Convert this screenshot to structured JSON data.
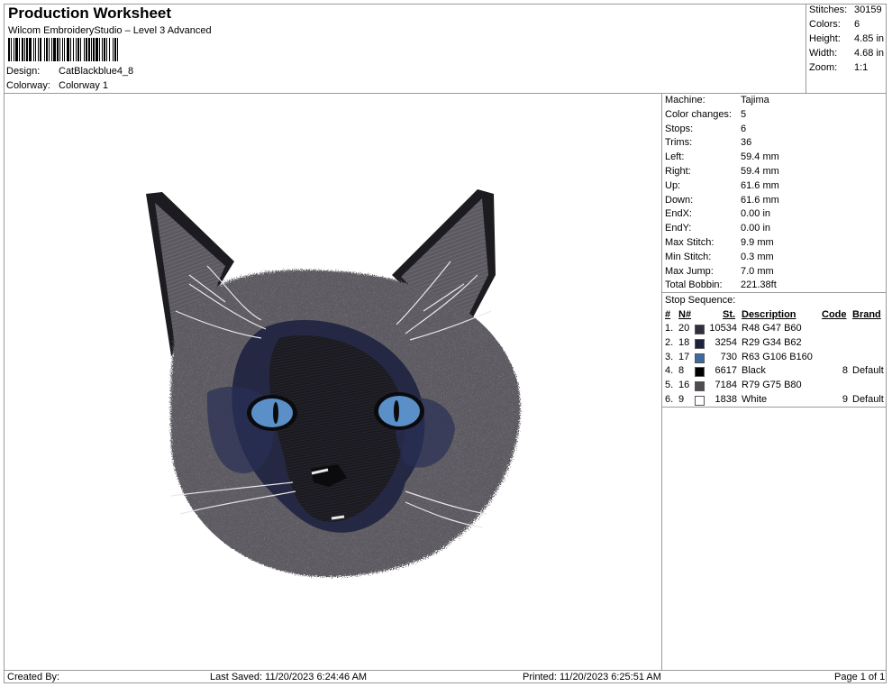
{
  "header": {
    "title": "Production Worksheet",
    "software": "Wilcom EmbroideryStudio – Level 3 Advanced",
    "design_label": "Design:",
    "design_value": "CatBlackblue4_8",
    "colorway_label": "Colorway:",
    "colorway_value": "Colorway 1"
  },
  "summary": {
    "stitches_label": "Stitches:",
    "stitches_value": "30159",
    "colors_label": "Colors:",
    "colors_value": "6",
    "height_label": "Height:",
    "height_value": "4.85 in",
    "width_label": "Width:",
    "width_value": "4.68 in",
    "zoom_label": "Zoom:",
    "zoom_value": "1:1"
  },
  "details": [
    {
      "label": "Machine:",
      "value": "Tajima"
    },
    {
      "label": "Color changes:",
      "value": "5"
    },
    {
      "label": "Stops:",
      "value": "6"
    },
    {
      "label": "Trims:",
      "value": "36"
    },
    {
      "label": "Left:",
      "value": "59.4 mm"
    },
    {
      "label": "Right:",
      "value": "59.4 mm"
    },
    {
      "label": "Up:",
      "value": "61.6 mm"
    },
    {
      "label": "Down:",
      "value": "61.6 mm"
    },
    {
      "label": "EndX:",
      "value": "0.00 in"
    },
    {
      "label": "EndY:",
      "value": "0.00 in"
    },
    {
      "label": "Max Stitch:",
      "value": "9.9 mm"
    },
    {
      "label": "Min Stitch:",
      "value": "0.3 mm"
    },
    {
      "label": "Max Jump:",
      "value": "7.0 mm"
    },
    {
      "label": "Total Bobbin:",
      "value": "221.38ft"
    }
  ],
  "stop_sequence": {
    "title": "Stop Sequence:",
    "headers": {
      "num": "#",
      "n": "N#",
      "st": "St.",
      "description": "Description",
      "code": "Code",
      "brand": "Brand"
    },
    "rows": [
      {
        "num": "1.",
        "n": "20",
        "st": "10534",
        "color": "#302f3c",
        "description": "R48 G47 B60",
        "code": "",
        "brand": ""
      },
      {
        "num": "2.",
        "n": "18",
        "st": "3254",
        "color": "#1d223e",
        "description": "R29 G34 B62",
        "code": "",
        "brand": ""
      },
      {
        "num": "3.",
        "n": "17",
        "st": "730",
        "color": "#3f6aa0",
        "description": "R63 G106 B160",
        "code": "",
        "brand": ""
      },
      {
        "num": "4.",
        "n": "8",
        "st": "6617",
        "color": "#000000",
        "description": "Black",
        "code": "8",
        "brand": "Default"
      },
      {
        "num": "5.",
        "n": "16",
        "st": "7184",
        "color": "#4f4b50",
        "description": "R79 G75 B80",
        "code": "",
        "brand": ""
      },
      {
        "num": "6.",
        "n": "9",
        "st": "1838",
        "color": "#ffffff",
        "description": "White",
        "code": "9",
        "brand": "Default"
      }
    ]
  },
  "footer": {
    "created_by": "Created By:",
    "last_saved": "Last Saved: 11/20/2023 6:24:46 AM",
    "printed": "Printed: 11/20/2023 6:25:51 AM",
    "page": "Page 1 of 1"
  },
  "colors": {
    "border": "#9a9a9a",
    "fur": "#5e5c60",
    "mask": "#1d223e",
    "eye": "#5a8fc8"
  }
}
